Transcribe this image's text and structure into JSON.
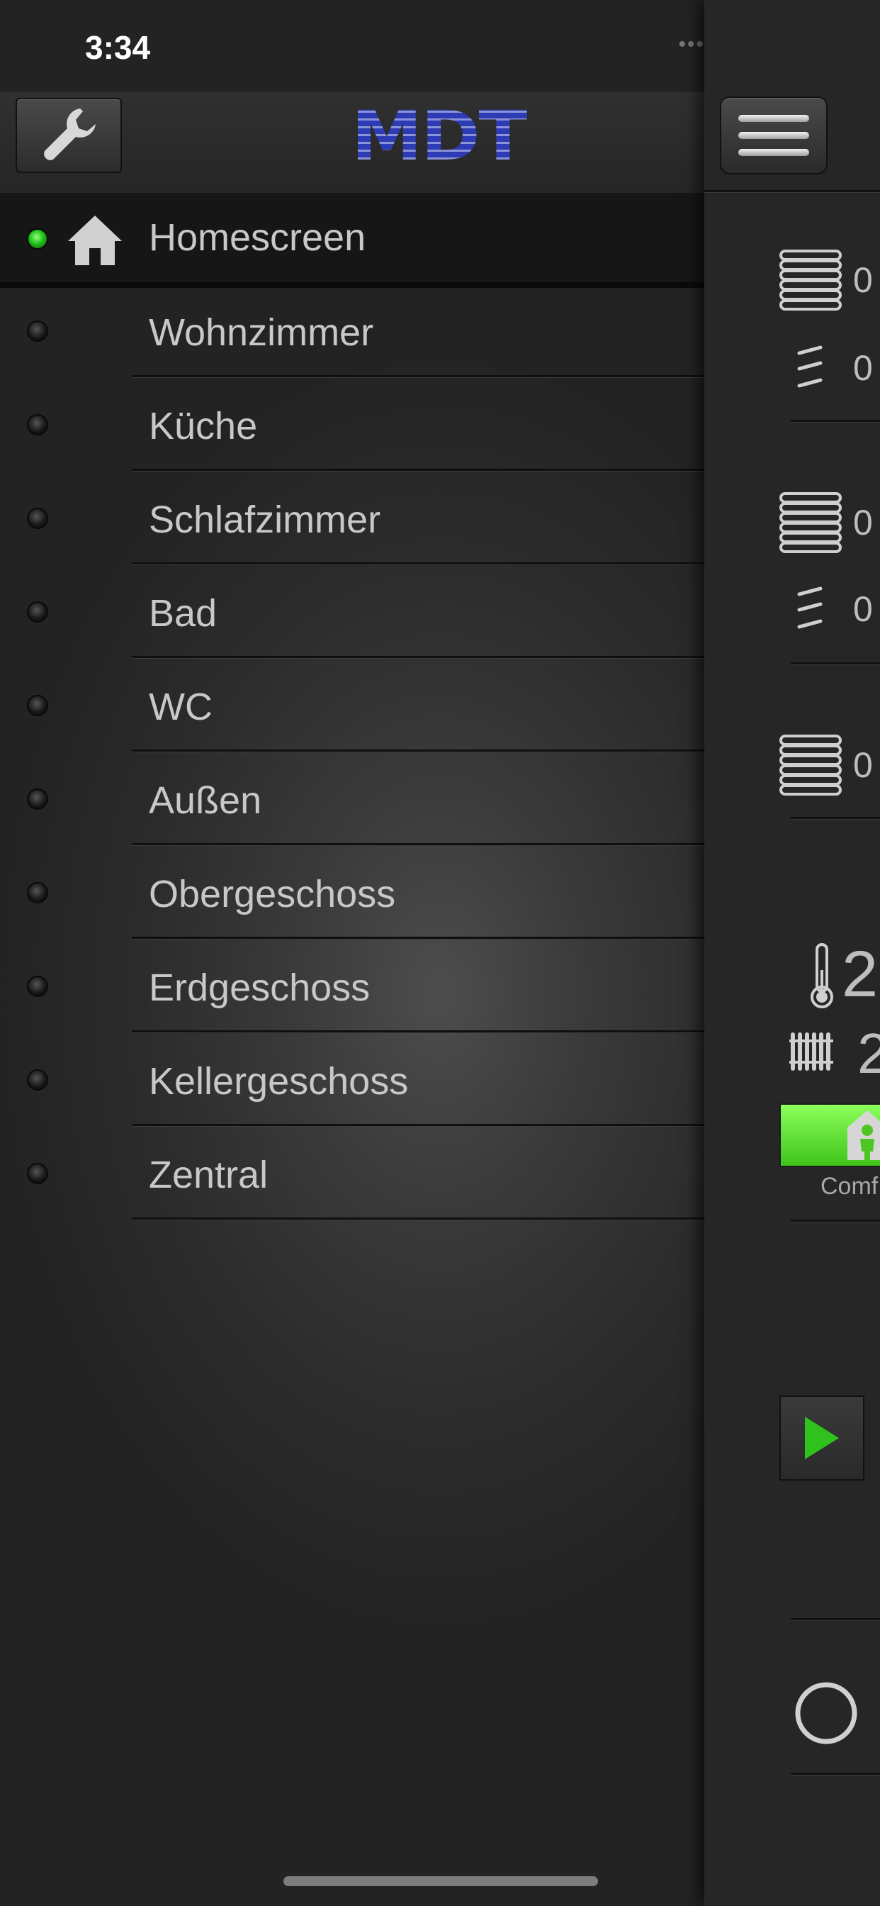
{
  "status_bar": {
    "time": "3:34"
  },
  "header": {
    "logo_text": "MDT"
  },
  "menu": {
    "items": [
      {
        "label": "Homescreen",
        "active": true,
        "icon": "home-icon"
      },
      {
        "label": "Wohnzimmer"
      },
      {
        "label": "Küche"
      },
      {
        "label": "Schlafzimmer"
      },
      {
        "label": "Bad"
      },
      {
        "label": "WC"
      },
      {
        "label": "Außen"
      },
      {
        "label": "Obergeschoss"
      },
      {
        "label": "Erdgeschoss"
      },
      {
        "label": "Kellergeschoss"
      },
      {
        "label": "Zentral"
      }
    ]
  },
  "right_panel": {
    "blind1_value": "0",
    "slat1_value": "0",
    "blind2_value": "0",
    "slat2_value": "0",
    "blind3_value": "0",
    "temp_value": "2",
    "heating_value": "2",
    "mode_label": "Comf"
  },
  "colors": {
    "active_led": "#22c31a",
    "logo_blue": "#2d3bb4",
    "comfort_green": "#5ee22e"
  }
}
